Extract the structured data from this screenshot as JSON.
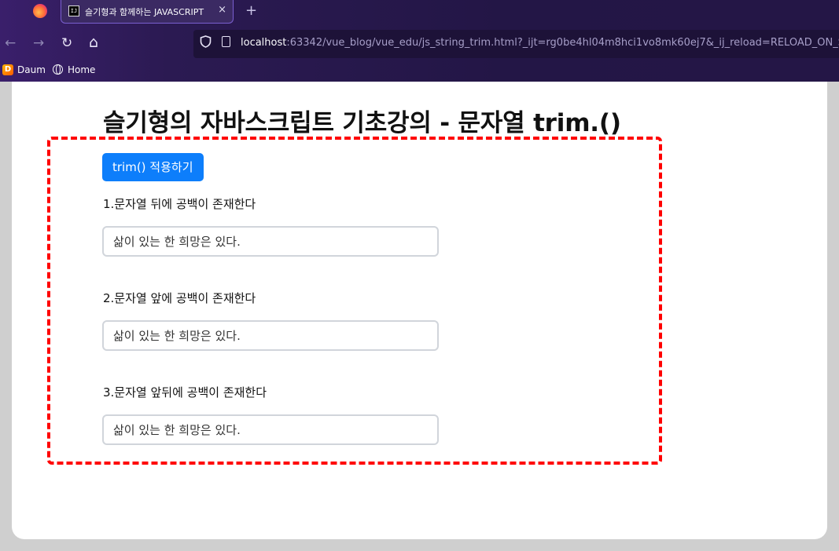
{
  "browser": {
    "tab_title": "슬기형과 함께하는 JAVASCRIPT",
    "tab_favicon": "IJ",
    "tab_close": "×",
    "new_tab": "+",
    "url_host": "localhost",
    "url_rest": ":63342/vue_blog/vue_edu/js_string_trim.html?_ijt=rg0be4hl04m8hci1vo8mk60ej7&_ij_reload=RELOAD_ON_SAVE",
    "nav_back": "←",
    "nav_forward": "→",
    "nav_reload": "↻",
    "nav_home": "⌂",
    "bookmarks": [
      {
        "label": "Daum",
        "icon": "daum-icon",
        "glyph": "D"
      },
      {
        "label": "Home",
        "icon": "globe-icon"
      }
    ]
  },
  "page": {
    "title": "슬기형의 자바스크립트 기초강의 - 문자열 trim.()",
    "trim_button_label": "trim() 적용하기",
    "fields": [
      {
        "label": "1.문자열 뒤에 공백이 존재한다",
        "value": "삶이 있는 한 희망은 있다."
      },
      {
        "label": "2.문자열 앞에 공백이 존재한다",
        "value": "삶이 있는 한 희망은 있다."
      },
      {
        "label": "3.문자열 앞뒤에 공백이 존재한다",
        "value": "삶이 있는 한 희망은 있다."
      }
    ]
  },
  "colors": {
    "button": "#0d7efb",
    "highlight_border": "#ff0000",
    "chrome": "#241646"
  }
}
